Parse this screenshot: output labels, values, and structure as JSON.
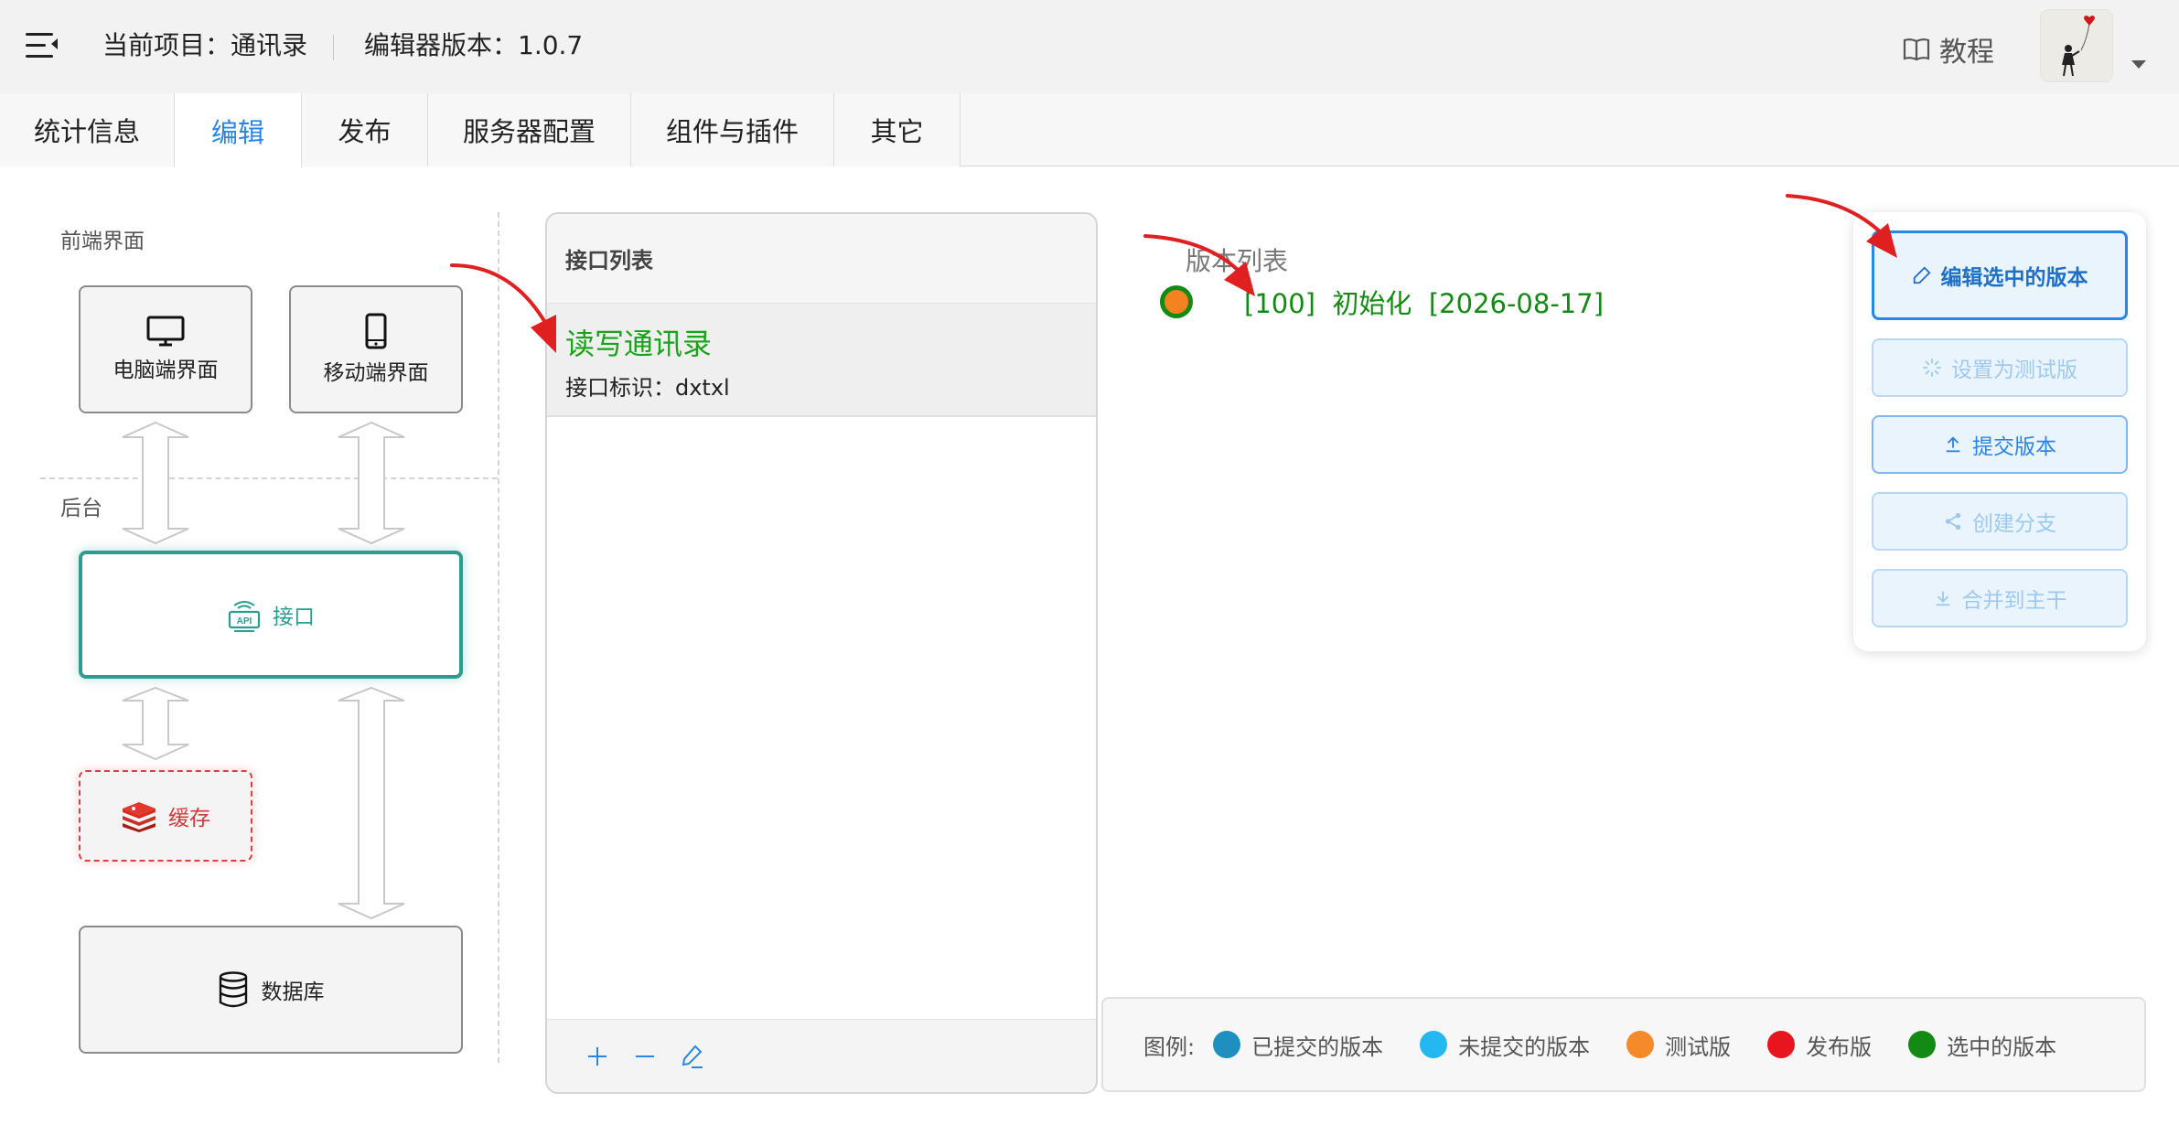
{
  "header": {
    "project_label": "当前项目：通讯录",
    "editor_version_label": "编辑器版本：1.0.7",
    "tutorial_label": "教程"
  },
  "tabs": [
    {
      "label": "统计信息"
    },
    {
      "label": "编辑",
      "active": true
    },
    {
      "label": "发布"
    },
    {
      "label": "服务器配置"
    },
    {
      "label": "组件与插件"
    },
    {
      "label": "其它"
    }
  ],
  "architecture": {
    "frontend_label": "前端界面",
    "backend_label": "后台",
    "pc_ui": "电脑端界面",
    "mobile_ui": "移动端界面",
    "api": "接口",
    "cache": "缓存",
    "database": "数据库"
  },
  "interface_list": {
    "title": "接口列表",
    "items": [
      {
        "name": "读写通讯录",
        "id_label": "接口标识：dxtxl"
      }
    ]
  },
  "version_list": {
    "title": "版本列表",
    "versions": [
      {
        "text": "[100]  初始化  [2026-08-17]",
        "status": "test-selected"
      }
    ]
  },
  "actions": {
    "edit_selected": "编辑选中的版本",
    "set_test": "设置为测试版",
    "submit": "提交版本",
    "create_branch": "创建分支",
    "merge": "合并到主干"
  },
  "legend": {
    "label": "图例:",
    "items": [
      {
        "label": "已提交的版本",
        "color": "#1f8fbf"
      },
      {
        "label": "未提交的版本",
        "color": "#25b7f0"
      },
      {
        "label": "测试版",
        "color": "#f58a2a"
      },
      {
        "label": "发布版",
        "color": "#e8151f"
      },
      {
        "label": "选中的版本",
        "color": "#138a13"
      }
    ]
  },
  "colors": {
    "accent": "#2b85e4",
    "api_teal": "#2a9d8f",
    "cache_red": "#d23a3a",
    "selected_green": "#138a13"
  }
}
